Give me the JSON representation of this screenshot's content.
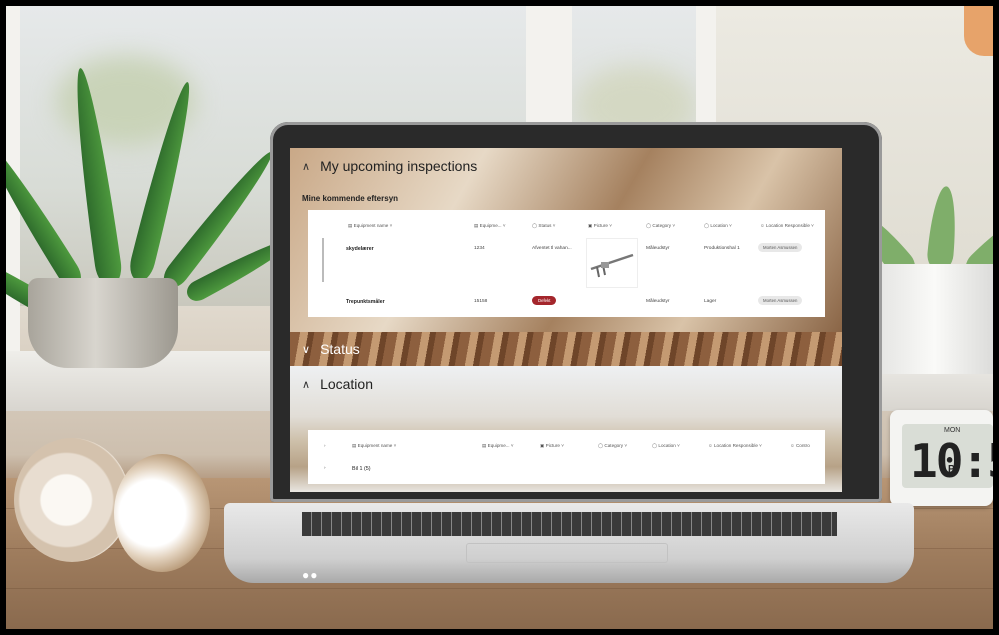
{
  "upcoming": {
    "title": "My upcoming inspections",
    "subtitle": "Mine kommende eftersyn",
    "columns": [
      "Equipment name",
      "Equipme...",
      "Status",
      "Picture",
      "Category",
      "Location",
      "Location Responsible"
    ],
    "rows": [
      {
        "name": "skydelærer",
        "id": "1234",
        "status": "Afventet tl vahan...",
        "category": "Måleudstyr",
        "location": "Produktionshal 1",
        "responsible": "Morten Asmussen"
      },
      {
        "name": "Trepunktsmåler",
        "id": "15158",
        "status": "Defekt",
        "category": "Måleudstyr",
        "location": "Lager",
        "responsible": "Morten Asmussen"
      }
    ]
  },
  "status_section": {
    "title": "Status"
  },
  "location_section": {
    "title": "Location",
    "columns": [
      "Equipment name",
      "Equipme...",
      "Picture",
      "Category",
      "Location",
      "Location Responsible",
      "Contro"
    ],
    "group_row": "Bil 1 (5)"
  },
  "clock": {
    "day": "MON",
    "time": "10:5",
    "ampm": "P"
  },
  "colors": {
    "defekt": "#a4262c",
    "laptop_bezel": "#2a2a2a"
  }
}
